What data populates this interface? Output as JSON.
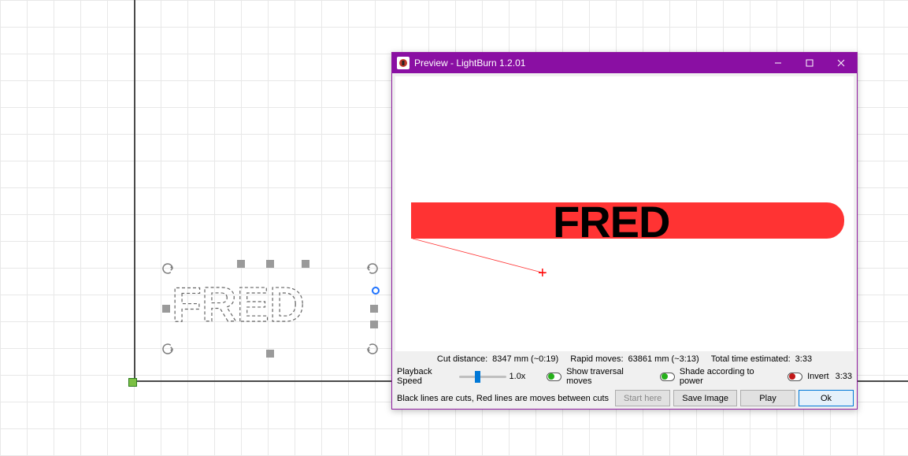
{
  "canvas": {
    "selected_text": "FRED"
  },
  "preview": {
    "title": "Preview - LightBurn 1.2.01",
    "render_text": "FRED",
    "stats": {
      "cut_label": "Cut distance:",
      "cut_value": "8347 mm (~0:19)",
      "rapid_label": "Rapid moves:",
      "rapid_value": "63861 mm (~3:13)",
      "total_label": "Total time estimated:",
      "total_value": "3:33"
    },
    "playback": {
      "label": "Playback Speed",
      "speed": "1.0x"
    },
    "toggles": {
      "traversal": "Show traversal moves",
      "shade": "Shade according to power",
      "invert": "Invert",
      "time": "3:33"
    },
    "hint": "Black lines are cuts, Red lines are moves between cuts",
    "buttons": {
      "start": "Start here",
      "save": "Save Image",
      "play": "Play",
      "ok": "Ok"
    }
  }
}
